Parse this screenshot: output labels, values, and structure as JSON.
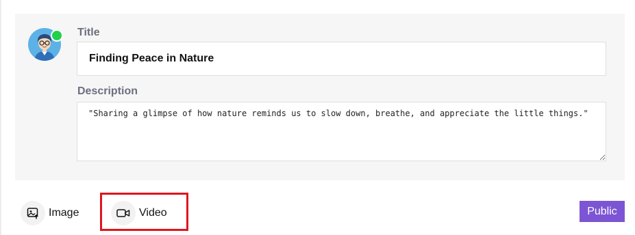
{
  "post_form": {
    "title_label": "Title",
    "title_value": "Finding Peace in Nature",
    "description_label": "Description",
    "description_value": "\"Sharing a glimpse of how nature reminds us to slow down, breathe, and appreciate the little things.\""
  },
  "user": {
    "status": "online",
    "status_color": "#21d04b"
  },
  "actions": {
    "image_label": "Image",
    "video_label": "Video",
    "visibility_label": "Public"
  },
  "colors": {
    "accent": "#7c55d4",
    "highlight": "#e0141e",
    "avatar_bg": "#5cb2e6",
    "panel_bg": "#f6f6f6"
  },
  "icons": {
    "image": "image-upload-icon",
    "video": "video-camera-icon"
  }
}
